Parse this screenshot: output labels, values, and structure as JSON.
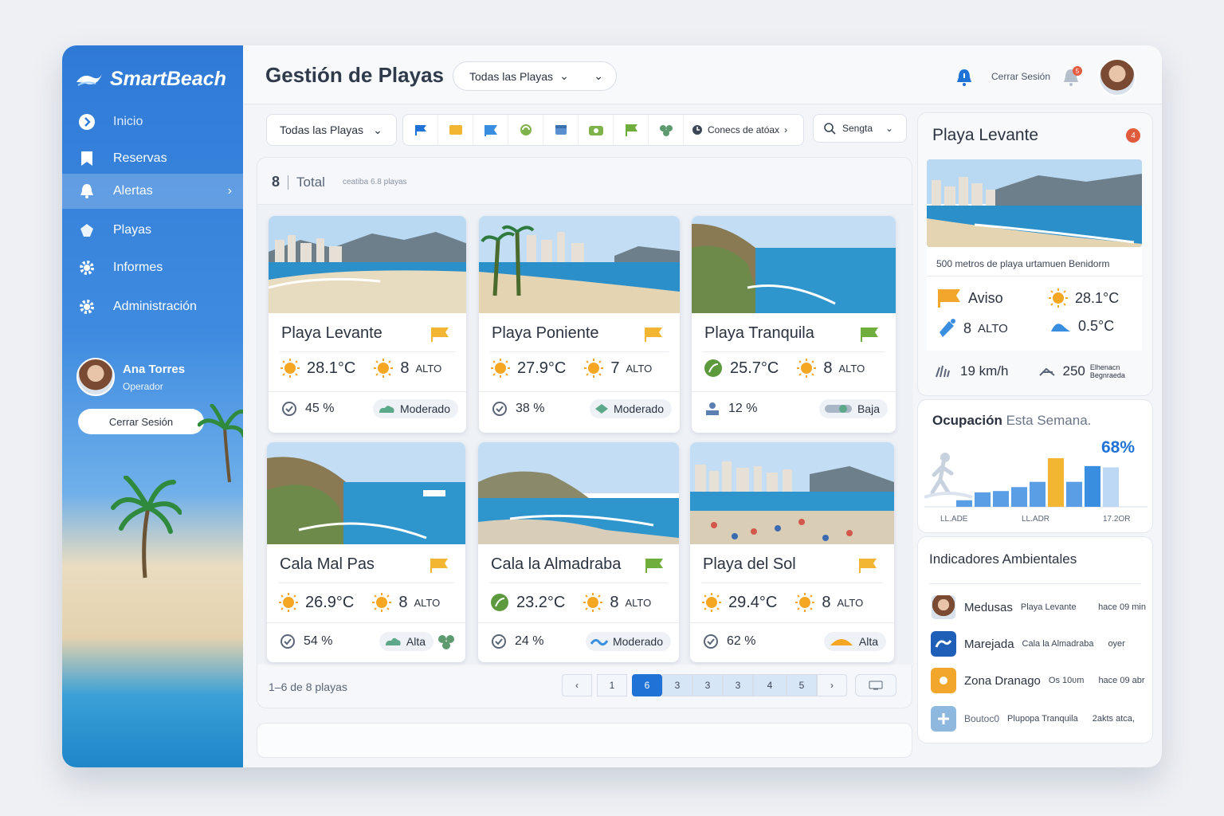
{
  "app": {
    "name": "SmartBeach"
  },
  "sidebar": {
    "items": [
      {
        "label": "Inicio",
        "icon": "chevron-circle-icon"
      },
      {
        "label": "Reservas",
        "icon": "bookmark-icon"
      },
      {
        "label": "Alertas",
        "icon": "bell-icon"
      },
      {
        "label": "Playas",
        "icon": "shell-icon"
      },
      {
        "label": "Informes",
        "icon": "gear-icon"
      },
      {
        "label": "Administración",
        "icon": "gear-icon"
      }
    ],
    "user": {
      "name": "Ana Torres",
      "role": "Operador"
    },
    "logout": "Cerrar Sesión"
  },
  "header": {
    "title": "Gestión de Playas",
    "dropdown": "Todas las Playas",
    "logout": "Cerrar Sesión",
    "bell_badge": "5"
  },
  "toolbar": {
    "dropdown": "Todas las Playas",
    "conects": "Conecs de atóax",
    "search": "Sengta"
  },
  "summary": {
    "count": "8",
    "label": "Total",
    "sub": "ceatiba 6.8 playas"
  },
  "beaches": [
    {
      "name": "Playa Levante",
      "temp": "28.1°C",
      "level": "8",
      "alto": "ALTO",
      "occ": "45 %",
      "status": "Moderado"
    },
    {
      "name": "Playa Poniente",
      "temp": "27.9°C",
      "level": "7",
      "alto": "ALTO",
      "occ": "38 %",
      "status": "Moderado"
    },
    {
      "name": "Playa Tranquila",
      "temp": "25.7°C",
      "level": "8",
      "alto": "ALTO",
      "occ": "12 %",
      "status": "Baja"
    },
    {
      "name": "Cala Mal Pas",
      "temp": "26.9°C",
      "level": "8",
      "alto": "ALTO",
      "occ": "54 %",
      "status": "Alta"
    },
    {
      "name": "Cala la Almadraba",
      "temp": "23.2°C",
      "level": "8",
      "alto": "ALTO",
      "occ": "24 %",
      "status": "Moderado"
    },
    {
      "name": "Playa del Sol",
      "temp": "29.4°C",
      "level": "8",
      "alto": "ALTO",
      "occ": "62 %",
      "status": "Alta"
    }
  ],
  "pagination": {
    "text": "1–6 de 8 playas",
    "pages": [
      "1",
      "6",
      "3",
      "3",
      "3",
      "4",
      "5"
    ]
  },
  "detail": {
    "title": "Playa Levante",
    "badge": "4",
    "desc": "500 metros de playa urtamuen Benidorm",
    "flag": "Aviso",
    "temp": "28.1°C",
    "level": "8",
    "alto": "ALTO",
    "water": "0.5°C",
    "wind": "19 km/h",
    "wave": "250",
    "wave_note1": "Elhenacn",
    "wave_note2": "Begnraeda"
  },
  "occupancy": {
    "title": "Ocupación",
    "subtitle": "Esta Semana.",
    "pct": "68%",
    "labels": [
      "LL.ADE",
      "LL.ADR",
      "17.2OR"
    ],
    "values": [
      10,
      22,
      24,
      30,
      38,
      74,
      38,
      62,
      60
    ],
    "highlight": [
      5,
      7
    ]
  },
  "environment": {
    "title": "Indicadores Ambientales",
    "items": [
      {
        "a": "Medusas",
        "b": "Playa Levante",
        "c": "hace 09 min"
      },
      {
        "a": "Marejada",
        "b": "Cala la Almadraba",
        "c": "oyer"
      },
      {
        "a": "Zona Dranago",
        "b": "Os 10ʋm",
        "c": "hace 09 abr"
      },
      {
        "a": "Boutoc0",
        "b": "Plupopa Tranquila",
        "c": "2akts atca,"
      }
    ]
  },
  "colors": {
    "primary": "#1f72d6",
    "flag_yellow": "#f2b632",
    "flag_green": "#6fae3c",
    "sun": "#f5a623"
  }
}
